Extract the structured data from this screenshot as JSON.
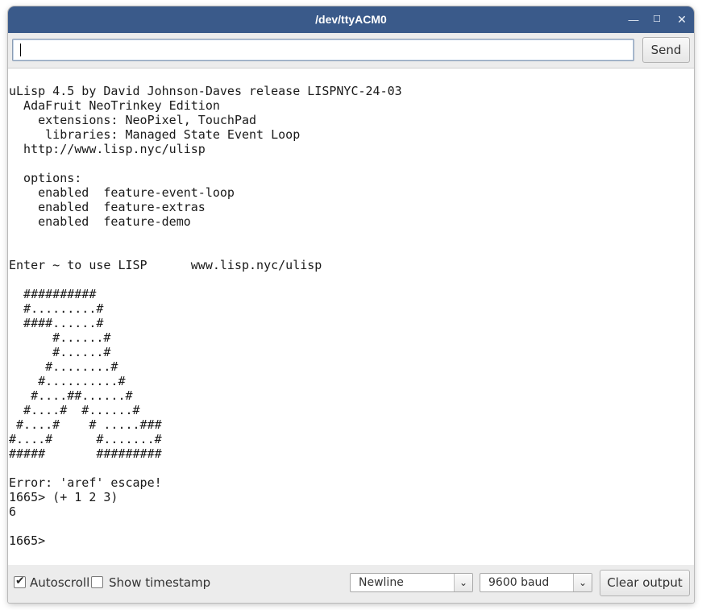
{
  "window": {
    "title": "/dev/ttyACM0",
    "minimize_glyph": "—",
    "maximize_glyph": "☐",
    "close_glyph": "✕"
  },
  "input": {
    "value": "",
    "send_label": "Send"
  },
  "output": {
    "text": "uLisp 4.5 by David Johnson-Daves release LISPNYC-24-03\n  AdaFruit NeoTrinkey Edition\n    extensions: NeoPixel, TouchPad\n     libraries: Managed State Event Loop\n  http://www.lisp.nyc/ulisp\n\n  options:\n    enabled  feature-event-loop\n    enabled  feature-extras\n    enabled  feature-demo\n\n\nEnter ~ to use LISP      www.lisp.nyc/ulisp\n\n  ##########\n  #.........#\n  ####......#\n      #......#\n      #......#\n     #........#\n    #..........#\n   #....##......#\n  #....#  #......#\n #....#    # .....###\n#....#      #.......#\n#####       #########\n\nError: 'aref' escape!\n1665> (+ 1 2 3)\n6\n\n1665>"
  },
  "status": {
    "autoscroll_label": "Autoscroll",
    "autoscroll_checked": true,
    "timestamp_label": "Show timestamp",
    "timestamp_checked": false,
    "line_ending": "Newline",
    "baud": "9600 baud",
    "clear_label": "Clear output"
  },
  "colors": {
    "titlebar": "#3a5a8a",
    "background": "#ececec"
  }
}
